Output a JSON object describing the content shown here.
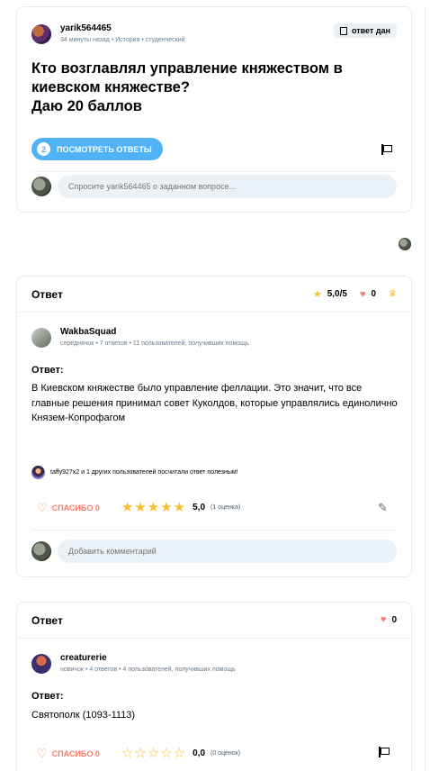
{
  "question": {
    "author": "yarik564465",
    "time": "34 минуты назад",
    "subject": "История",
    "grade": "студенческий",
    "status": "ответ дан",
    "title": "Кто возглавлял управление княжеством в киевском княжестве?",
    "points": "Даю 20 баллов",
    "answers_count": "2",
    "view_answers_label": "посмотреть ответы",
    "comment_placeholder": "Спросите yarik564465 о заданном вопросе..."
  },
  "answers": [
    {
      "header": "Ответ",
      "rating_summary": "5,0/5",
      "likes": "0",
      "author": "WakbaSquad",
      "rank": "середнячок",
      "answers_stat": "7 ответов",
      "helped_stat": "11 пользователей, получивших помощь",
      "label": "Ответ:",
      "text": "В Киевском княжестве было управление феллации. Это значит, что все главные решения принимал совет Куколдов, которые управлялись единолично Князем-Копрофагом",
      "helpful_note": "taffy927x2 и 1 других пользователей посчитали ответ полезным!",
      "thanks_label": "спасибо 0",
      "rating_value": "5,0",
      "rating_count": "(1 оценка)",
      "stars_filled": 5,
      "comment_placeholder": "Добавить комментарий"
    },
    {
      "header": "Ответ",
      "likes": "0",
      "author": "creaturerie",
      "rank": "новичок",
      "answers_stat": "4 ответов",
      "helped_stat": "4 пользователей, получивших помощь",
      "label": "Ответ:",
      "text": "Святополк (1093-1113)",
      "thanks_label": "спасибо 0",
      "rating_value": "0,0",
      "rating_count": "(0 оценок)",
      "stars_filled": 0
    }
  ],
  "colors": {
    "accent": "#4fb3f6",
    "heart": "#ff7968",
    "star": "#fbbe2e"
  }
}
